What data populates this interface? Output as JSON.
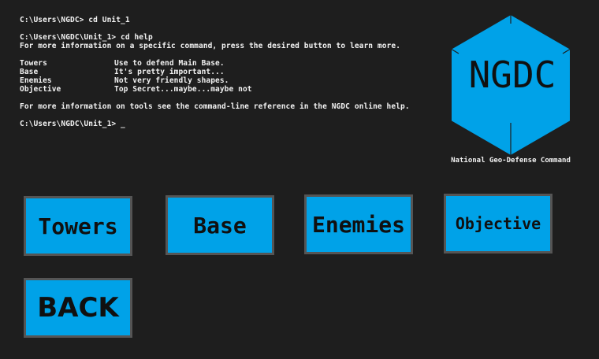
{
  "console": {
    "line1": "C:\\Users\\NGDC> cd Unit_1",
    "line2": "C:\\Users\\NGDC\\Unit_1> cd help",
    "line3": "For more information on a specific command, press the desired button to learn more.",
    "help": [
      {
        "cmd": "Towers",
        "desc": "Use to defend Main Base."
      },
      {
        "cmd": "Base",
        "desc": "It's pretty important..."
      },
      {
        "cmd": "Enemies",
        "desc": "Not very friendly shapes."
      },
      {
        "cmd": "Objective",
        "desc": "Top Secret...maybe...maybe not"
      }
    ],
    "line4": "For more information on tools see the command-line reference in the NGDC online help.",
    "prompt": "C:\\Users\\NGDC\\Unit_1> _"
  },
  "logo": {
    "text": "NGDC",
    "caption": "National Geo-Defense Command",
    "fill_color": "#00a2e8",
    "edge_color": "#1e1e1e"
  },
  "buttons": {
    "towers": "Towers",
    "base": "Base",
    "enemies": "Enemies",
    "objective": "Objective",
    "back": "BACK",
    "fill_color": "#00a2e8",
    "border_color": "#555555"
  }
}
